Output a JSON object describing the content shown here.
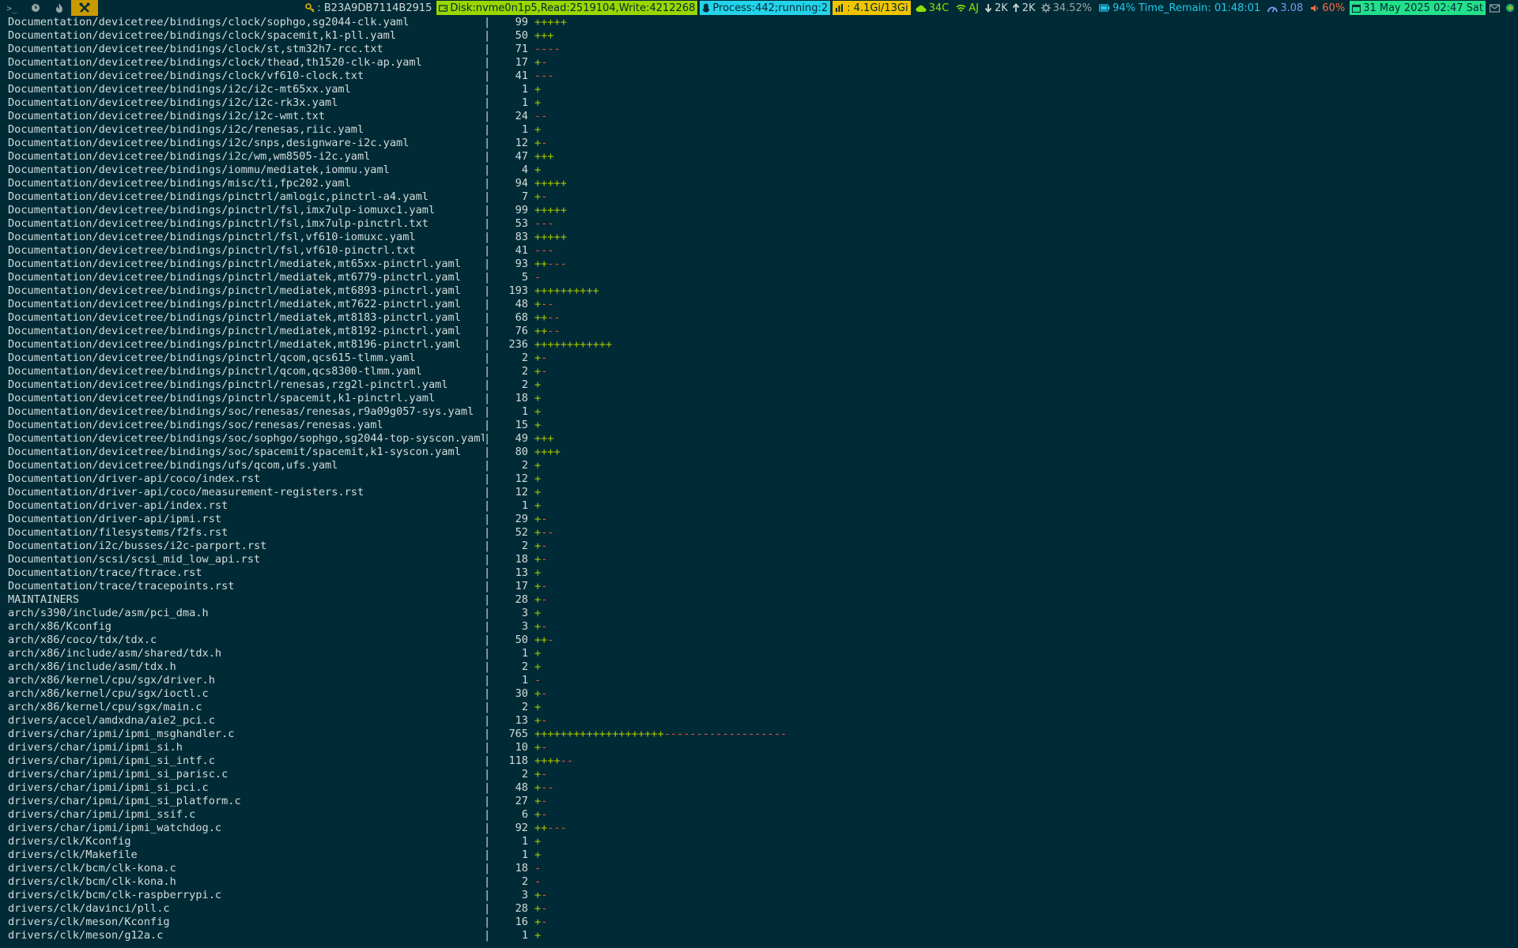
{
  "statusbar": {
    "workspaces": [
      {
        "label": ">_",
        "icon": "terminal-icon",
        "active": false
      },
      {
        "label": "",
        "icon": "clock-icon",
        "active": false
      },
      {
        "label": "",
        "icon": "flame-icon",
        "active": false
      },
      {
        "label": "",
        "icon": "tools-icon",
        "active": true
      }
    ],
    "key_text": ": B23A9DB7114B2915",
    "disk_text": "Disk:nvme0n1p5,Read:2519104,Write:4212268",
    "process_text": "Process:442;running:2",
    "memory_text": ": 4.1Gi/13Gi",
    "temperature_text": "34C",
    "wifi_text": "AJ",
    "download_text": "2K",
    "upload_text": "2K",
    "cpu_text": "34.52%",
    "battery_text": "94% Time_Remain: 01:48:01",
    "load_text": "3.08",
    "volume_text": "60%",
    "date_text": "31 May 2025 02:47 Sat",
    "colors": {
      "background": "#002b36",
      "disk": "#9bd600",
      "process": "#23d3ea",
      "memory": "#f0c400",
      "date": "#23e08a",
      "volume": "#ff6a3a",
      "plus": "#a8c400",
      "minus": "#e8533b"
    }
  },
  "diffstat": [
    {
      "path": "Documentation/devicetree/bindings/clock/sophgo,sg2044-clk.yaml",
      "count": "99",
      "plus": "+++++",
      "minus": ""
    },
    {
      "path": "Documentation/devicetree/bindings/clock/spacemit,k1-pll.yaml",
      "count": "50",
      "plus": "+++",
      "minus": ""
    },
    {
      "path": "Documentation/devicetree/bindings/clock/st,stm32h7-rcc.txt",
      "count": "71",
      "plus": "",
      "minus": "----"
    },
    {
      "path": "Documentation/devicetree/bindings/clock/thead,th1520-clk-ap.yaml",
      "count": "17",
      "plus": "+",
      "minus": "-"
    },
    {
      "path": "Documentation/devicetree/bindings/clock/vf610-clock.txt",
      "count": "41",
      "plus": "",
      "minus": "---"
    },
    {
      "path": "Documentation/devicetree/bindings/i2c/i2c-mt65xx.yaml",
      "count": "1",
      "plus": "+",
      "minus": ""
    },
    {
      "path": "Documentation/devicetree/bindings/i2c/i2c-rk3x.yaml",
      "count": "1",
      "plus": "+",
      "minus": ""
    },
    {
      "path": "Documentation/devicetree/bindings/i2c/i2c-wmt.txt",
      "count": "24",
      "plus": "",
      "minus": "--"
    },
    {
      "path": "Documentation/devicetree/bindings/i2c/renesas,riic.yaml",
      "count": "1",
      "plus": "+",
      "minus": ""
    },
    {
      "path": "Documentation/devicetree/bindings/i2c/snps,designware-i2c.yaml",
      "count": "12",
      "plus": "+",
      "minus": "-"
    },
    {
      "path": "Documentation/devicetree/bindings/i2c/wm,wm8505-i2c.yaml",
      "count": "47",
      "plus": "+++",
      "minus": ""
    },
    {
      "path": "Documentation/devicetree/bindings/iommu/mediatek,iommu.yaml",
      "count": "4",
      "plus": "+",
      "minus": ""
    },
    {
      "path": "Documentation/devicetree/bindings/misc/ti,fpc202.yaml",
      "count": "94",
      "plus": "+++++",
      "minus": ""
    },
    {
      "path": "Documentation/devicetree/bindings/pinctrl/amlogic,pinctrl-a4.yaml",
      "count": "7",
      "plus": "+",
      "minus": "-"
    },
    {
      "path": "Documentation/devicetree/bindings/pinctrl/fsl,imx7ulp-iomuxc1.yaml",
      "count": "99",
      "plus": "+++++",
      "minus": ""
    },
    {
      "path": "Documentation/devicetree/bindings/pinctrl/fsl,imx7ulp-pinctrl.txt",
      "count": "53",
      "plus": "",
      "minus": "---"
    },
    {
      "path": "Documentation/devicetree/bindings/pinctrl/fsl,vf610-iomuxc.yaml",
      "count": "83",
      "plus": "+++++",
      "minus": ""
    },
    {
      "path": "Documentation/devicetree/bindings/pinctrl/fsl,vf610-pinctrl.txt",
      "count": "41",
      "plus": "",
      "minus": "---"
    },
    {
      "path": "Documentation/devicetree/bindings/pinctrl/mediatek,mt65xx-pinctrl.yaml",
      "count": "93",
      "plus": "++",
      "minus": "---"
    },
    {
      "path": "Documentation/devicetree/bindings/pinctrl/mediatek,mt6779-pinctrl.yaml",
      "count": "5",
      "plus": "",
      "minus": "-"
    },
    {
      "path": "Documentation/devicetree/bindings/pinctrl/mediatek,mt6893-pinctrl.yaml",
      "count": "193",
      "plus": "++++++++++",
      "minus": ""
    },
    {
      "path": "Documentation/devicetree/bindings/pinctrl/mediatek,mt7622-pinctrl.yaml",
      "count": "48",
      "plus": "+",
      "minus": "--"
    },
    {
      "path": "Documentation/devicetree/bindings/pinctrl/mediatek,mt8183-pinctrl.yaml",
      "count": "68",
      "plus": "++",
      "minus": "--"
    },
    {
      "path": "Documentation/devicetree/bindings/pinctrl/mediatek,mt8192-pinctrl.yaml",
      "count": "76",
      "plus": "++",
      "minus": "--"
    },
    {
      "path": "Documentation/devicetree/bindings/pinctrl/mediatek,mt8196-pinctrl.yaml",
      "count": "236",
      "plus": "++++++++++++",
      "minus": ""
    },
    {
      "path": "Documentation/devicetree/bindings/pinctrl/qcom,qcs615-tlmm.yaml",
      "count": "2",
      "plus": "+",
      "minus": "-"
    },
    {
      "path": "Documentation/devicetree/bindings/pinctrl/qcom,qcs8300-tlmm.yaml",
      "count": "2",
      "plus": "+",
      "minus": "-"
    },
    {
      "path": "Documentation/devicetree/bindings/pinctrl/renesas,rzg2l-pinctrl.yaml",
      "count": "2",
      "plus": "+",
      "minus": ""
    },
    {
      "path": "Documentation/devicetree/bindings/pinctrl/spacemit,k1-pinctrl.yaml",
      "count": "18",
      "plus": "+",
      "minus": ""
    },
    {
      "path": "Documentation/devicetree/bindings/soc/renesas/renesas,r9a09g057-sys.yaml",
      "count": "1",
      "plus": "+",
      "minus": ""
    },
    {
      "path": "Documentation/devicetree/bindings/soc/renesas/renesas.yaml",
      "count": "15",
      "plus": "+",
      "minus": ""
    },
    {
      "path": "Documentation/devicetree/bindings/soc/sophgo/sophgo,sg2044-top-syscon.yaml",
      "count": "49",
      "plus": "+++",
      "minus": ""
    },
    {
      "path": "Documentation/devicetree/bindings/soc/spacemit/spacemit,k1-syscon.yaml",
      "count": "80",
      "plus": "++++",
      "minus": ""
    },
    {
      "path": "Documentation/devicetree/bindings/ufs/qcom,ufs.yaml",
      "count": "2",
      "plus": "+",
      "minus": ""
    },
    {
      "path": "Documentation/driver-api/coco/index.rst",
      "count": "12",
      "plus": "+",
      "minus": ""
    },
    {
      "path": "Documentation/driver-api/coco/measurement-registers.rst",
      "count": "12",
      "plus": "+",
      "minus": ""
    },
    {
      "path": "Documentation/driver-api/index.rst",
      "count": "1",
      "plus": "+",
      "minus": ""
    },
    {
      "path": "Documentation/driver-api/ipmi.rst",
      "count": "29",
      "plus": "+",
      "minus": "-"
    },
    {
      "path": "Documentation/filesystems/f2fs.rst",
      "count": "52",
      "plus": "+",
      "minus": "--"
    },
    {
      "path": "Documentation/i2c/busses/i2c-parport.rst",
      "count": "2",
      "plus": "+",
      "minus": "-"
    },
    {
      "path": "Documentation/scsi/scsi_mid_low_api.rst",
      "count": "18",
      "plus": "+",
      "minus": "-"
    },
    {
      "path": "Documentation/trace/ftrace.rst",
      "count": "13",
      "plus": "+",
      "minus": ""
    },
    {
      "path": "Documentation/trace/tracepoints.rst",
      "count": "17",
      "plus": "+",
      "minus": "-"
    },
    {
      "path": "MAINTAINERS",
      "count": "28",
      "plus": "+",
      "minus": "-"
    },
    {
      "path": "arch/s390/include/asm/pci_dma.h",
      "count": "3",
      "plus": "+",
      "minus": ""
    },
    {
      "path": "arch/x86/Kconfig",
      "count": "3",
      "plus": "+",
      "minus": "-"
    },
    {
      "path": "arch/x86/coco/tdx/tdx.c",
      "count": "50",
      "plus": "++",
      "minus": "-"
    },
    {
      "path": "arch/x86/include/asm/shared/tdx.h",
      "count": "1",
      "plus": "+",
      "minus": ""
    },
    {
      "path": "arch/x86/include/asm/tdx.h",
      "count": "2",
      "plus": "+",
      "minus": ""
    },
    {
      "path": "arch/x86/kernel/cpu/sgx/driver.h",
      "count": "1",
      "plus": "",
      "minus": "-"
    },
    {
      "path": "arch/x86/kernel/cpu/sgx/ioctl.c",
      "count": "30",
      "plus": "+",
      "minus": "-"
    },
    {
      "path": "arch/x86/kernel/cpu/sgx/main.c",
      "count": "2",
      "plus": "+",
      "minus": ""
    },
    {
      "path": "drivers/accel/amdxdna/aie2_pci.c",
      "count": "13",
      "plus": "+",
      "minus": "-"
    },
    {
      "path": "drivers/char/ipmi/ipmi_msghandler.c",
      "count": "765",
      "plus": "++++++++++++++++++++",
      "minus": "-------------------"
    },
    {
      "path": "drivers/char/ipmi/ipmi_si.h",
      "count": "10",
      "plus": "+",
      "minus": "-"
    },
    {
      "path": "drivers/char/ipmi/ipmi_si_intf.c",
      "count": "118",
      "plus": "++++",
      "minus": "--"
    },
    {
      "path": "drivers/char/ipmi/ipmi_si_parisc.c",
      "count": "2",
      "plus": "+",
      "minus": "-"
    },
    {
      "path": "drivers/char/ipmi/ipmi_si_pci.c",
      "count": "48",
      "plus": "+",
      "minus": "--"
    },
    {
      "path": "drivers/char/ipmi/ipmi_si_platform.c",
      "count": "27",
      "plus": "+",
      "minus": "-"
    },
    {
      "path": "drivers/char/ipmi/ipmi_ssif.c",
      "count": "6",
      "plus": "+",
      "minus": "-"
    },
    {
      "path": "drivers/char/ipmi/ipmi_watchdog.c",
      "count": "92",
      "plus": "++",
      "minus": "---"
    },
    {
      "path": "drivers/clk/Kconfig",
      "count": "1",
      "plus": "+",
      "minus": ""
    },
    {
      "path": "drivers/clk/Makefile",
      "count": "1",
      "plus": "+",
      "minus": ""
    },
    {
      "path": "drivers/clk/bcm/clk-kona.c",
      "count": "18",
      "plus": "",
      "minus": "-"
    },
    {
      "path": "drivers/clk/bcm/clk-kona.h",
      "count": "2",
      "plus": "",
      "minus": "-"
    },
    {
      "path": "drivers/clk/bcm/clk-raspberrypi.c",
      "count": "3",
      "plus": "+",
      "minus": "-"
    },
    {
      "path": "drivers/clk/davinci/pll.c",
      "count": "28",
      "plus": "+",
      "minus": "-"
    },
    {
      "path": "drivers/clk/meson/Kconfig",
      "count": "16",
      "plus": "+",
      "minus": "-"
    },
    {
      "path": "drivers/clk/meson/g12a.c",
      "count": "1",
      "plus": "+",
      "minus": ""
    }
  ]
}
